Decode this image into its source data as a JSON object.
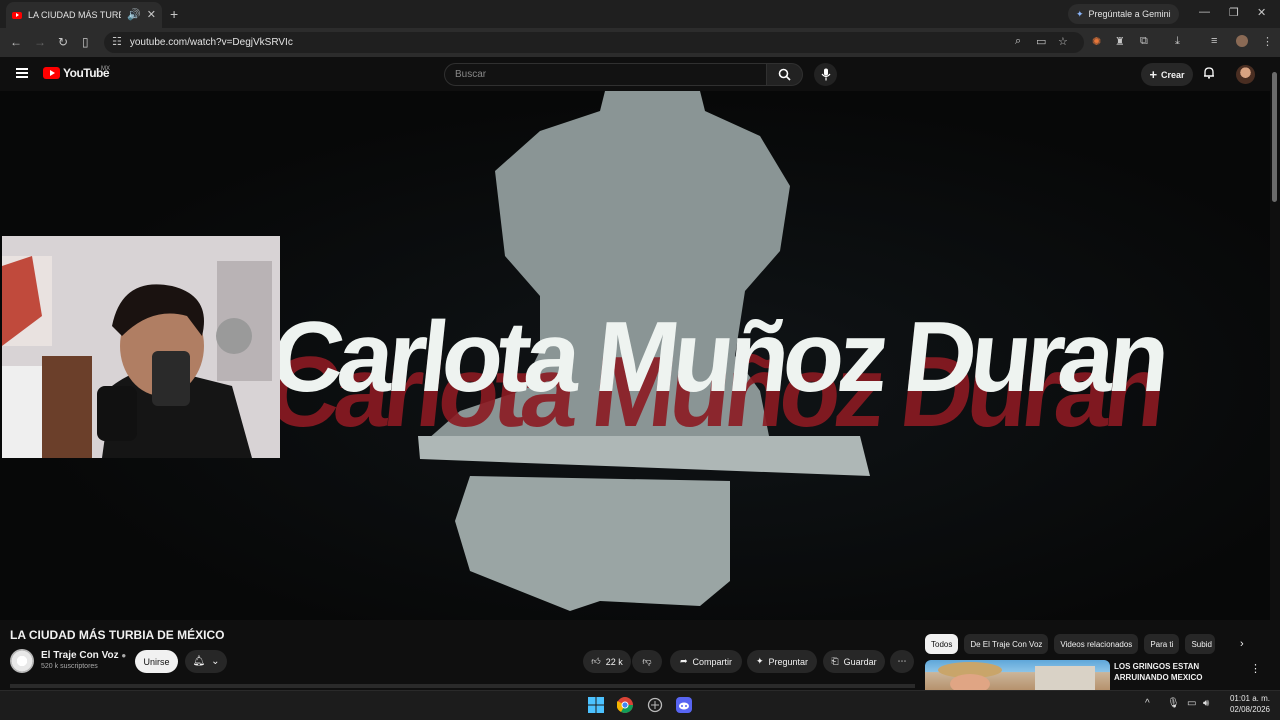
{
  "browser": {
    "tab_title": "LA CIUDAD MÁS TURBIA DE",
    "gemini_label": "Pregúntale a Gemini",
    "url": "youtube.com/watch?v=DegjVkSRVIc"
  },
  "youtube": {
    "logo_text": "YouTube",
    "country_code": "MX",
    "search_placeholder": "Buscar",
    "create_label": "Crear"
  },
  "video": {
    "overlay_text": "Carlota Muñoz Duran",
    "title": "LA CIUDAD MÁS TURBIA DE MÉXICO",
    "channel_name": "El Traje Con Voz",
    "subscribers": "520 k suscriptores",
    "join_label": "Unirse",
    "likes": "22 k",
    "share_label": "Compartir",
    "ask_label": "Preguntar",
    "save_label": "Guardar"
  },
  "chips": [
    "Todos",
    "De El Traje Con Voz",
    "Videos relacionados",
    "Para ti",
    "Subid"
  ],
  "related": {
    "title": "LOS GRINGOS ESTAN ARRUINANDO MEXICO"
  },
  "taskbar": {
    "time": "01:01 a. m.",
    "date": "02/08/2026"
  },
  "colors": {
    "brand_red": "#ff0000",
    "page_bg": "#0f0f0f",
    "chip_bg": "#272727"
  }
}
